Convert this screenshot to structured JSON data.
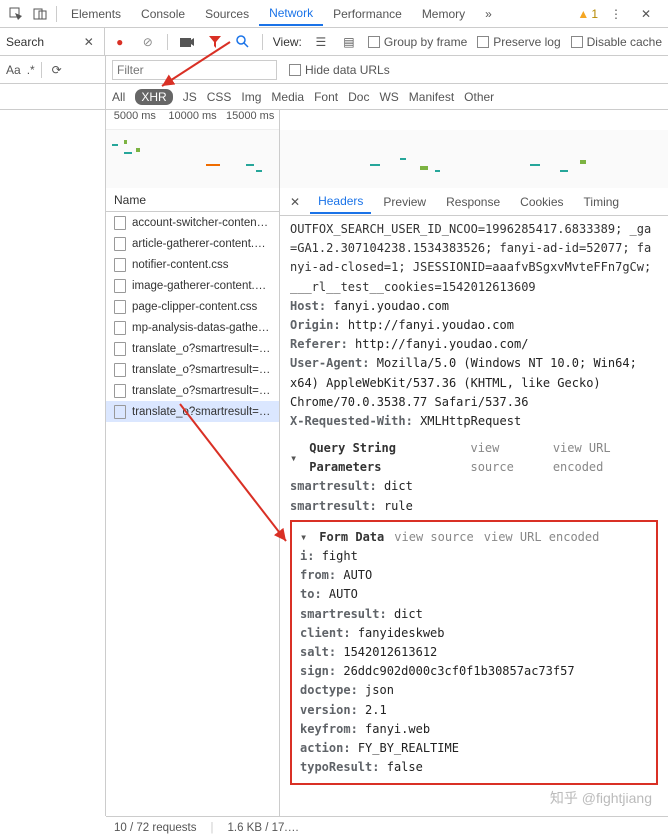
{
  "topTabs": {
    "elements": "Elements",
    "console": "Console",
    "sources": "Sources",
    "network": "Network",
    "performance": "Performance",
    "memory": "Memory",
    "moreGlyph": "»",
    "warningCount": "1"
  },
  "searchRow": {
    "searchLabel": "Search",
    "viewLabel": "View:",
    "groupByFrame": "Group by frame",
    "preserveLog": "Preserve log",
    "disableCache": "Disable cache"
  },
  "filterRow": {
    "aa": "Aa",
    "regex": ".*",
    "filterPlaceholder": "Filter",
    "hideDataUrls": "Hide data URLs"
  },
  "typeRow": {
    "all": "All",
    "xhr": "XHR",
    "js": "JS",
    "css": "CSS",
    "img": "Img",
    "media": "Media",
    "font": "Font",
    "doc": "Doc",
    "ws": "WS",
    "manifest": "Manifest",
    "other": "Other"
  },
  "timeline": {
    "t1": "5000 ms",
    "t2": "10000 ms",
    "t3": "15000 ms"
  },
  "nameHeader": "Name",
  "requests": [
    "account-switcher-conten…",
    "article-gatherer-content.c…",
    "notifier-content.css",
    "image-gatherer-content.…",
    "page-clipper-content.css",
    "mp-analysis-datas-gathe…",
    "translate_o?smartresult=…",
    "translate_o?smartresult=…",
    "translate_o?smartresult=…",
    "translate_o?smartresult=…"
  ],
  "detailTabs": {
    "headers": "Headers",
    "preview": "Preview",
    "response": "Response",
    "cookies": "Cookies",
    "timing": "Timing"
  },
  "headers": {
    "cookieLine": "OUTFOX_SEARCH_USER_ID_NCOO=1996285417.6833389; _ga=GA1.2.307104238.1534383526; fanyi-ad-id=52077; fanyi-ad-closed=1; JSESSIONID=aaafvBSgxvMvteFFn7gCw; ___rl__test__cookies=1542012613609",
    "hostK": "Host:",
    "hostV": "fanyi.youdao.com",
    "originK": "Origin:",
    "originV": "http://fanyi.youdao.com",
    "refererK": "Referer:",
    "refererV": "http://fanyi.youdao.com/",
    "uaK": "User-Agent:",
    "uaV": "Mozilla/5.0 (Windows NT 10.0; Win64; x64) AppleWebKit/537.36 (KHTML, like Gecko) Chrome/70.0.3538.77 Safari/537.36",
    "xrwK": "X-Requested-With:",
    "xrwV": "XMLHttpRequest"
  },
  "qsp": {
    "title": "Query String Parameters",
    "viewSource": "view source",
    "viewUrlEncoded": "view URL encoded",
    "items": [
      {
        "k": "smartresult:",
        "v": "dict"
      },
      {
        "k": "smartresult:",
        "v": "rule"
      }
    ]
  },
  "formData": {
    "title": "Form Data",
    "viewSource": "view source",
    "viewUrlEncoded": "view URL encoded",
    "items": [
      {
        "k": "i:",
        "v": "fight"
      },
      {
        "k": "from:",
        "v": "AUTO"
      },
      {
        "k": "to:",
        "v": "AUTO"
      },
      {
        "k": "smartresult:",
        "v": "dict"
      },
      {
        "k": "client:",
        "v": "fanyideskweb"
      },
      {
        "k": "salt:",
        "v": "1542012613612"
      },
      {
        "k": "sign:",
        "v": "26ddc902d000c3cf0f1b30857ac73f57"
      },
      {
        "k": "doctype:",
        "v": "json"
      },
      {
        "k": "version:",
        "v": "2.1"
      },
      {
        "k": "keyfrom:",
        "v": "fanyi.web"
      },
      {
        "k": "action:",
        "v": "FY_BY_REALTIME"
      },
      {
        "k": "typoResult:",
        "v": "false"
      }
    ]
  },
  "statusBar": {
    "requests": "10 / 72 requests",
    "transferred": "1.6 KB / 17.…"
  },
  "watermark": "知乎 @fightjiang"
}
